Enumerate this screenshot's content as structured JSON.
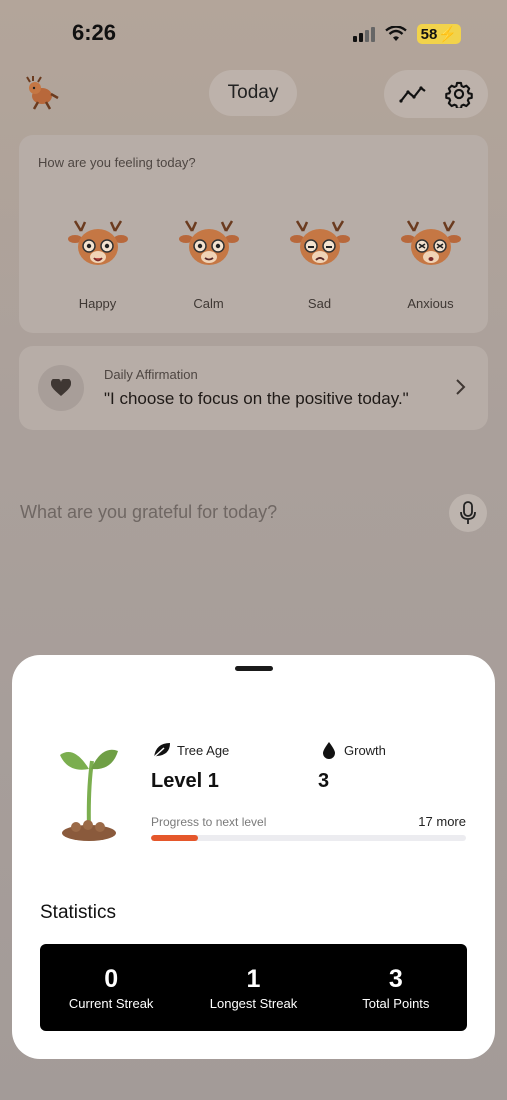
{
  "status_bar": {
    "time": "6:26",
    "battery": "58"
  },
  "header": {
    "today_label": "Today",
    "icons": [
      "deer-logo-icon",
      "trend-chart-icon",
      "gear-icon"
    ]
  },
  "mood": {
    "question": "How are you feeling today?",
    "options": [
      {
        "label": "Happy"
      },
      {
        "label": "Calm"
      },
      {
        "label": "Sad"
      },
      {
        "label": "Anxious"
      }
    ]
  },
  "affirmation": {
    "title": "Daily Affirmation",
    "text": "\"I choose to focus on the positive today.\""
  },
  "gratitude": {
    "placeholder": "What are you grateful for today?"
  },
  "tree": {
    "age_label": "Tree Age",
    "level": "Level 1",
    "growth_label": "Growth",
    "growth_value": "3",
    "progress_label": "Progress to next level",
    "progress_remaining": "17 more",
    "progress_fraction": 0.15
  },
  "statistics": {
    "title": "Statistics",
    "items": [
      {
        "value": "0",
        "label": "Current Streak"
      },
      {
        "value": "1",
        "label": "Longest Streak"
      },
      {
        "value": "3",
        "label": "Total Points"
      }
    ]
  },
  "colors": {
    "accent": "#e5572b",
    "plant_green": "#7bae4f",
    "soil": "#8a5a3c"
  }
}
